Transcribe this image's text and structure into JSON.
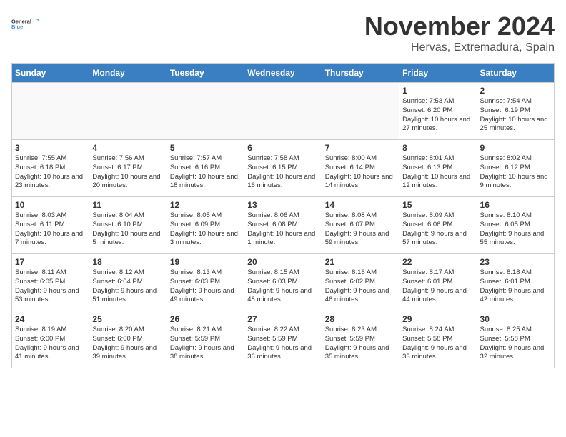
{
  "logo": {
    "line1": "General",
    "line2": "Blue"
  },
  "title": "November 2024",
  "location": "Hervas, Extremadura, Spain",
  "days_of_week": [
    "Sunday",
    "Monday",
    "Tuesday",
    "Wednesday",
    "Thursday",
    "Friday",
    "Saturday"
  ],
  "weeks": [
    [
      {
        "day": "",
        "info": ""
      },
      {
        "day": "",
        "info": ""
      },
      {
        "day": "",
        "info": ""
      },
      {
        "day": "",
        "info": ""
      },
      {
        "day": "",
        "info": ""
      },
      {
        "day": "1",
        "info": "Sunrise: 7:53 AM\nSunset: 6:20 PM\nDaylight: 10 hours and 27 minutes."
      },
      {
        "day": "2",
        "info": "Sunrise: 7:54 AM\nSunset: 6:19 PM\nDaylight: 10 hours and 25 minutes."
      }
    ],
    [
      {
        "day": "3",
        "info": "Sunrise: 7:55 AM\nSunset: 6:18 PM\nDaylight: 10 hours and 23 minutes."
      },
      {
        "day": "4",
        "info": "Sunrise: 7:56 AM\nSunset: 6:17 PM\nDaylight: 10 hours and 20 minutes."
      },
      {
        "day": "5",
        "info": "Sunrise: 7:57 AM\nSunset: 6:16 PM\nDaylight: 10 hours and 18 minutes."
      },
      {
        "day": "6",
        "info": "Sunrise: 7:58 AM\nSunset: 6:15 PM\nDaylight: 10 hours and 16 minutes."
      },
      {
        "day": "7",
        "info": "Sunrise: 8:00 AM\nSunset: 6:14 PM\nDaylight: 10 hours and 14 minutes."
      },
      {
        "day": "8",
        "info": "Sunrise: 8:01 AM\nSunset: 6:13 PM\nDaylight: 10 hours and 12 minutes."
      },
      {
        "day": "9",
        "info": "Sunrise: 8:02 AM\nSunset: 6:12 PM\nDaylight: 10 hours and 9 minutes."
      }
    ],
    [
      {
        "day": "10",
        "info": "Sunrise: 8:03 AM\nSunset: 6:11 PM\nDaylight: 10 hours and 7 minutes."
      },
      {
        "day": "11",
        "info": "Sunrise: 8:04 AM\nSunset: 6:10 PM\nDaylight: 10 hours and 5 minutes."
      },
      {
        "day": "12",
        "info": "Sunrise: 8:05 AM\nSunset: 6:09 PM\nDaylight: 10 hours and 3 minutes."
      },
      {
        "day": "13",
        "info": "Sunrise: 8:06 AM\nSunset: 6:08 PM\nDaylight: 10 hours and 1 minute."
      },
      {
        "day": "14",
        "info": "Sunrise: 8:08 AM\nSunset: 6:07 PM\nDaylight: 9 hours and 59 minutes."
      },
      {
        "day": "15",
        "info": "Sunrise: 8:09 AM\nSunset: 6:06 PM\nDaylight: 9 hours and 57 minutes."
      },
      {
        "day": "16",
        "info": "Sunrise: 8:10 AM\nSunset: 6:05 PM\nDaylight: 9 hours and 55 minutes."
      }
    ],
    [
      {
        "day": "17",
        "info": "Sunrise: 8:11 AM\nSunset: 6:05 PM\nDaylight: 9 hours and 53 minutes."
      },
      {
        "day": "18",
        "info": "Sunrise: 8:12 AM\nSunset: 6:04 PM\nDaylight: 9 hours and 51 minutes."
      },
      {
        "day": "19",
        "info": "Sunrise: 8:13 AM\nSunset: 6:03 PM\nDaylight: 9 hours and 49 minutes."
      },
      {
        "day": "20",
        "info": "Sunrise: 8:15 AM\nSunset: 6:03 PM\nDaylight: 9 hours and 48 minutes."
      },
      {
        "day": "21",
        "info": "Sunrise: 8:16 AM\nSunset: 6:02 PM\nDaylight: 9 hours and 46 minutes."
      },
      {
        "day": "22",
        "info": "Sunrise: 8:17 AM\nSunset: 6:01 PM\nDaylight: 9 hours and 44 minutes."
      },
      {
        "day": "23",
        "info": "Sunrise: 8:18 AM\nSunset: 6:01 PM\nDaylight: 9 hours and 42 minutes."
      }
    ],
    [
      {
        "day": "24",
        "info": "Sunrise: 8:19 AM\nSunset: 6:00 PM\nDaylight: 9 hours and 41 minutes."
      },
      {
        "day": "25",
        "info": "Sunrise: 8:20 AM\nSunset: 6:00 PM\nDaylight: 9 hours and 39 minutes."
      },
      {
        "day": "26",
        "info": "Sunrise: 8:21 AM\nSunset: 5:59 PM\nDaylight: 9 hours and 38 minutes."
      },
      {
        "day": "27",
        "info": "Sunrise: 8:22 AM\nSunset: 5:59 PM\nDaylight: 9 hours and 36 minutes."
      },
      {
        "day": "28",
        "info": "Sunrise: 8:23 AM\nSunset: 5:59 PM\nDaylight: 9 hours and 35 minutes."
      },
      {
        "day": "29",
        "info": "Sunrise: 8:24 AM\nSunset: 5:58 PM\nDaylight: 9 hours and 33 minutes."
      },
      {
        "day": "30",
        "info": "Sunrise: 8:25 AM\nSunset: 5:58 PM\nDaylight: 9 hours and 32 minutes."
      }
    ]
  ]
}
